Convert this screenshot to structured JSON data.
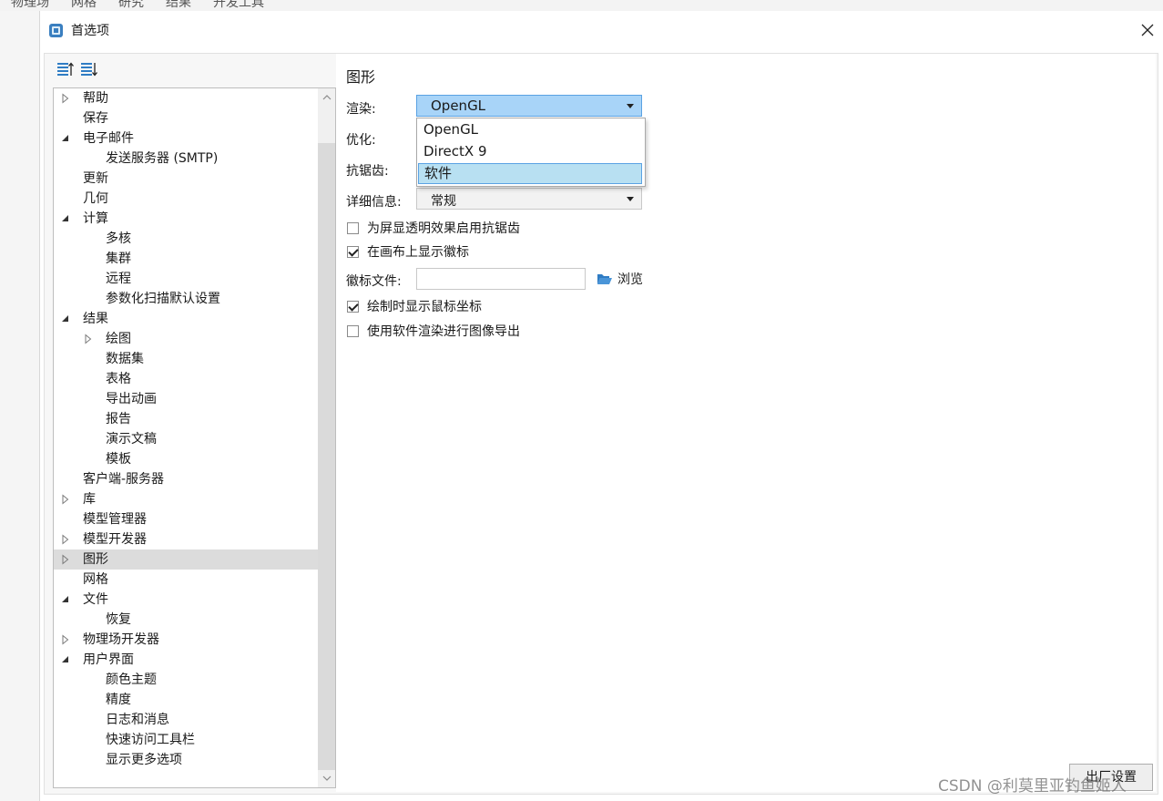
{
  "background_menu": [
    "物理场",
    "网格",
    "研究",
    "结果",
    "开发工具"
  ],
  "dialog": {
    "title": "首选项",
    "close_symbol": "✕",
    "export_button": "出厂设置",
    "watermark": "CSDN @利莫里亚钓鱼姬人"
  },
  "toolbar": {
    "icons": [
      "sort-ascending-icon",
      "sort-descending-icon"
    ]
  },
  "tree": {
    "selected": "图形",
    "items": [
      {
        "label": "帮助",
        "level": 0,
        "expander": "collapsed"
      },
      {
        "label": "保存",
        "level": 0,
        "expander": "none"
      },
      {
        "label": "电子邮件",
        "level": 0,
        "expander": "expanded"
      },
      {
        "label": "发送服务器 (SMTP)",
        "level": 1,
        "expander": "none"
      },
      {
        "label": "更新",
        "level": 0,
        "expander": "none"
      },
      {
        "label": "几何",
        "level": 0,
        "expander": "none"
      },
      {
        "label": "计算",
        "level": 0,
        "expander": "expanded"
      },
      {
        "label": "多核",
        "level": 1,
        "expander": "none"
      },
      {
        "label": "集群",
        "level": 1,
        "expander": "none"
      },
      {
        "label": "远程",
        "level": 1,
        "expander": "none"
      },
      {
        "label": "参数化扫描默认设置",
        "level": 1,
        "expander": "none"
      },
      {
        "label": "结果",
        "level": 0,
        "expander": "expanded"
      },
      {
        "label": "绘图",
        "level": 1,
        "expander": "collapsed"
      },
      {
        "label": "数据集",
        "level": 1,
        "expander": "none"
      },
      {
        "label": "表格",
        "level": 1,
        "expander": "none"
      },
      {
        "label": "导出动画",
        "level": 1,
        "expander": "none"
      },
      {
        "label": "报告",
        "level": 1,
        "expander": "none"
      },
      {
        "label": "演示文稿",
        "level": 1,
        "expander": "none"
      },
      {
        "label": "模板",
        "level": 1,
        "expander": "none"
      },
      {
        "label": "客户端-服务器",
        "level": 0,
        "expander": "none"
      },
      {
        "label": "库",
        "level": 0,
        "expander": "collapsed"
      },
      {
        "label": "模型管理器",
        "level": 0,
        "expander": "none"
      },
      {
        "label": "模型开发器",
        "level": 0,
        "expander": "collapsed"
      },
      {
        "label": "图形",
        "level": 0,
        "expander": "collapsed"
      },
      {
        "label": "网格",
        "level": 0,
        "expander": "none"
      },
      {
        "label": "文件",
        "level": 0,
        "expander": "expanded"
      },
      {
        "label": "恢复",
        "level": 1,
        "expander": "none"
      },
      {
        "label": "物理场开发器",
        "level": 0,
        "expander": "collapsed"
      },
      {
        "label": "用户界面",
        "level": 0,
        "expander": "expanded"
      },
      {
        "label": "颜色主题",
        "level": 1,
        "expander": "none"
      },
      {
        "label": "精度",
        "level": 1,
        "expander": "none"
      },
      {
        "label": "日志和消息",
        "level": 1,
        "expander": "none"
      },
      {
        "label": "快速访问工具栏",
        "level": 1,
        "expander": "none"
      },
      {
        "label": "显示更多选项",
        "level": 1,
        "expander": "none"
      }
    ]
  },
  "graphics": {
    "title": "图形",
    "render_label": "渲染:",
    "render_value": "OpenGL",
    "render_options": [
      "OpenGL",
      "DirectX 9",
      "软件"
    ],
    "render_highlighted": "软件",
    "optimize_label": "优化:",
    "antialias_label": "抗锯齿:",
    "detail_label": "详细信息:",
    "detail_value": "常规",
    "checkboxes": [
      {
        "label": "为屏显透明效果启用抗锯齿",
        "checked": false
      },
      {
        "label": "在画布上显示徽标",
        "checked": true
      },
      {
        "label": "绘制时显示鼠标坐标",
        "checked": true
      },
      {
        "label": "使用软件渲染进行图像导出",
        "checked": false
      }
    ],
    "logo_file_label": "徽标文件:",
    "logo_file_value": "",
    "browse_label": "浏览"
  },
  "colors": {
    "combo_active": "#a8d4f8",
    "combo_active_border": "#5aa2e3",
    "selected_row": "#dcdcdc",
    "folder_icon": "#2f7cc4"
  }
}
